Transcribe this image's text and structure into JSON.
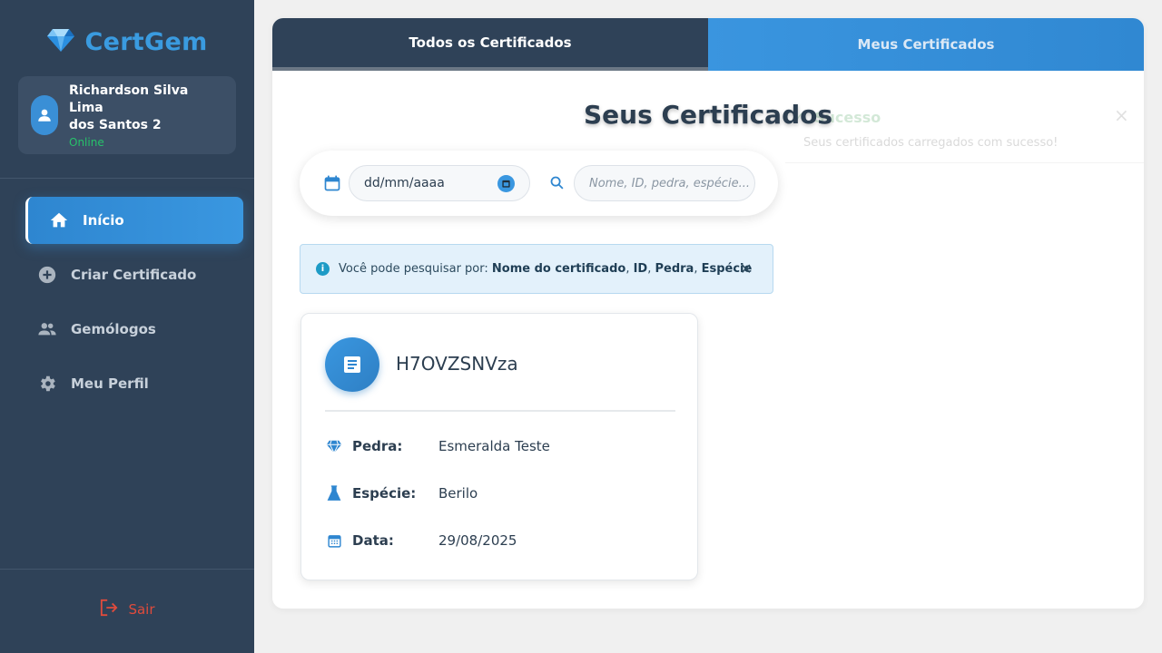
{
  "sidebar": {
    "brand": "CertGem",
    "user": {
      "name_line1": "Richardson Silva Lima",
      "name_line2": "dos Santos 2",
      "status": "Online"
    },
    "items": [
      {
        "label": "Início",
        "icon": "home-icon",
        "active": true
      },
      {
        "label": "Criar Certificado",
        "icon": "add-circle-icon"
      },
      {
        "label": "Gemólogos",
        "icon": "people-icon"
      },
      {
        "label": "Meu Perfil",
        "icon": "gear-icon"
      }
    ],
    "logout": "Sair"
  },
  "tabs": [
    {
      "label": "Todos os Certificados",
      "active": true
    },
    {
      "label": "Meus Certificados"
    }
  ],
  "toast": {
    "title": "Sucesso",
    "message": "Seus certificados carregados com sucesso!"
  },
  "main": {
    "title": "Seus Certificados",
    "date_placeholder": "dd/mm/aaaa",
    "search_placeholder": "Nome, ID, pedra, espécie..."
  },
  "info": {
    "prefix": "Você pode pesquisar por:",
    "fields": [
      "Nome do certificado",
      "ID",
      "Pedra",
      "Espécie"
    ],
    "sep": ","
  },
  "certificate": {
    "id": "H7OVZSNVza",
    "rows": [
      {
        "label": "Pedra:",
        "value": "Esmeralda Teste",
        "icon": "diamond-icon"
      },
      {
        "label": "Espécie:",
        "value": "Berilo",
        "icon": "flask-icon"
      },
      {
        "label": "Data:",
        "value": "29/08/2025",
        "icon": "calendar-icon"
      }
    ]
  },
  "colors": {
    "accent": "#3a97e0",
    "sidebar": "#2f4258",
    "logout": "#e04b3c",
    "online": "#27c26a"
  }
}
